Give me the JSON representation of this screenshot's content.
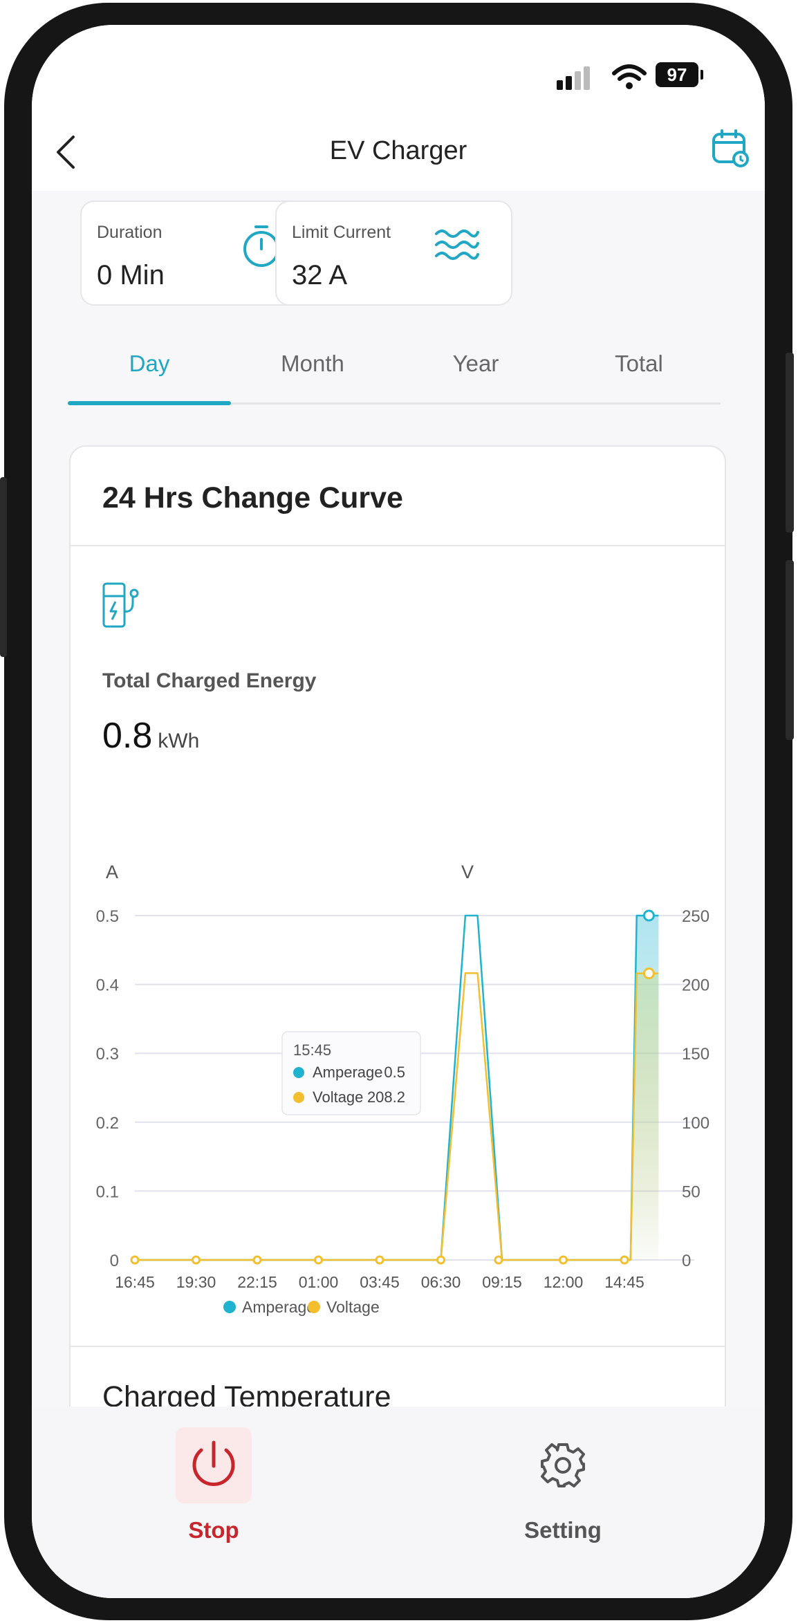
{
  "status_bar": {
    "battery": "97"
  },
  "header": {
    "title": "EV Charger"
  },
  "duration": {
    "label": "Duration",
    "value": "0 Min"
  },
  "limit": {
    "label": "Limit Current",
    "value": "32 A"
  },
  "tabs": [
    {
      "label": "Day"
    },
    {
      "label": "Month"
    },
    {
      "label": "Year"
    },
    {
      "label": "Total"
    }
  ],
  "curve": {
    "title": "24 Hrs Change Curve",
    "energy_label": "Total Charged Energy",
    "energy_value": "0.8",
    "energy_unit": "kWh"
  },
  "temperature": {
    "title": "Charged Temperature"
  },
  "bottom": {
    "stop_label": "Stop",
    "setting_label": "Setting"
  },
  "colors": {
    "accent": "#1fa7c4",
    "amperage": "#1fb3cf",
    "voltage": "#f3bf2e",
    "stop": "#c8262c"
  },
  "chart_data": {
    "type": "line",
    "y_left_label": "A",
    "y_right_label": "V",
    "y_left_ticks": [
      "0.5",
      "0.4",
      "0.3",
      "0.2",
      "0.1",
      "0"
    ],
    "y_right_ticks": [
      "250",
      "200",
      "150",
      "100",
      "50",
      "0"
    ],
    "y_left_range": [
      0,
      0.5
    ],
    "y_right_range": [
      0,
      250
    ],
    "x_ticks": [
      "16:45",
      "19:30",
      "22:15",
      "01:00",
      "03:45",
      "06:30",
      "09:15",
      "12:00",
      "14:45"
    ],
    "series": [
      {
        "name": "Amperage",
        "points": [
          [
            0,
            0
          ],
          [
            5,
            0
          ],
          [
            5.4,
            0.5
          ],
          [
            5.6,
            0.5
          ],
          [
            6,
            0
          ],
          [
            8.1,
            0
          ],
          [
            8.2,
            0.5
          ],
          [
            8.4,
            0.5
          ]
        ]
      },
      {
        "name": "Voltage",
        "points": [
          [
            0,
            0
          ],
          [
            5,
            0
          ],
          [
            5.4,
            208.2
          ],
          [
            5.6,
            208.2
          ],
          [
            6,
            0
          ],
          [
            8.1,
            0
          ],
          [
            8.2,
            208
          ],
          [
            8.4,
            208
          ]
        ]
      }
    ],
    "tooltip": {
      "time": "15:45",
      "rows": [
        {
          "name": "Amperage",
          "value": "0.5"
        },
        {
          "name": "Voltage",
          "value": "208.2"
        }
      ]
    },
    "legend": [
      "Amperage",
      "Voltage"
    ],
    "grid": true,
    "legend_position": "bottom"
  }
}
